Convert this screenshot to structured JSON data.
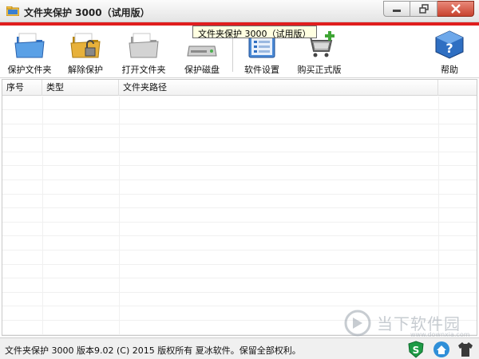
{
  "window": {
    "title": "文件夹保护 3000（试用版）",
    "tooltip": "文件夹保护 3000（试用版）"
  },
  "toolbar": {
    "buttons": [
      {
        "label": "保护文件夹",
        "icon": "folder-icon"
      },
      {
        "label": "解除保护",
        "icon": "unlocked-folder-icon"
      },
      {
        "label": "打开文件夹",
        "icon": "open-folder-icon"
      },
      {
        "label": "保护磁盘",
        "icon": "disk-icon"
      },
      {
        "label": "软件设置",
        "icon": "settings-window-icon"
      },
      {
        "label": "购买正式版",
        "icon": "cart-icon"
      },
      {
        "label": "帮助",
        "icon": "help-icon"
      }
    ]
  },
  "list": {
    "columns": [
      "序号",
      "类型",
      "文件夹路径"
    ],
    "rows": []
  },
  "watermark": {
    "text": "当下软件园",
    "url": "www.downxia.com"
  },
  "statusbar": {
    "text": "文件夹保护 3000 版本9.02 (C) 2015 版权所有 夏冰软件。保留全部权利。"
  },
  "colors": {
    "accent_red": "#e01e1e",
    "tooltip_bg": "#ffffe1",
    "folder_blue": "#3a7fd0"
  }
}
